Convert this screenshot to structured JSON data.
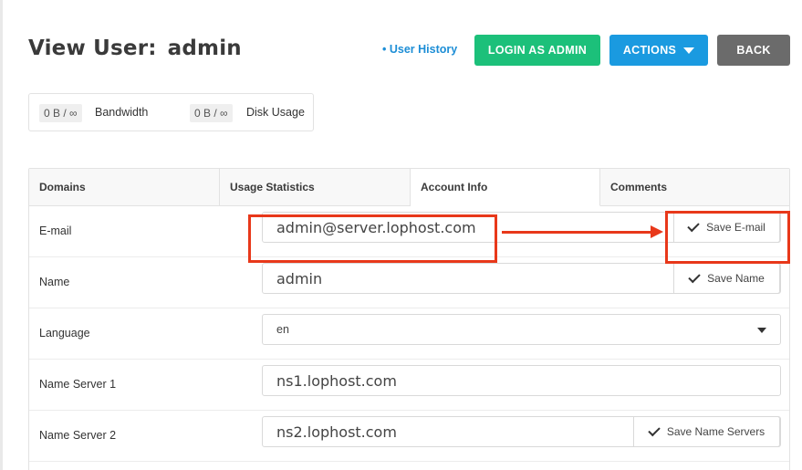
{
  "header": {
    "title_prefix": "View User:",
    "username": "admin",
    "user_history_link": "• User History",
    "login_as_admin_label": "LOGIN AS ADMIN",
    "actions_label": "ACTIONS",
    "back_label": "BACK"
  },
  "usage": {
    "bandwidth_value": "0 B / ∞",
    "bandwidth_label": "Bandwidth",
    "disk_value": "0 B / ∞",
    "disk_label": "Disk Usage"
  },
  "tabs": [
    {
      "label": "Domains",
      "active": false
    },
    {
      "label": "Usage Statistics",
      "active": false
    },
    {
      "label": "Account Info",
      "active": true
    },
    {
      "label": "Comments",
      "active": false
    }
  ],
  "account_info": {
    "email": {
      "label": "E-mail",
      "value": "admin@server.lophost.com",
      "button": "Save E-mail"
    },
    "name": {
      "label": "Name",
      "value": "admin",
      "button": "Save Name"
    },
    "language": {
      "label": "Language",
      "value": "en"
    },
    "ns1": {
      "label": "Name Server 1",
      "value": "ns1.lophost.com"
    },
    "ns2": {
      "label": "Name Server 2",
      "value": "ns2.lophost.com",
      "button": "Save Name Servers"
    }
  },
  "colors": {
    "login_button": "#1cc07a",
    "actions_button": "#1a9ae0",
    "back_button": "#6b6b6b",
    "link": "#1d8ed6",
    "annotation": "#e8381a"
  },
  "icons": {
    "check": "check-icon",
    "caret": "chevron-down-icon"
  }
}
